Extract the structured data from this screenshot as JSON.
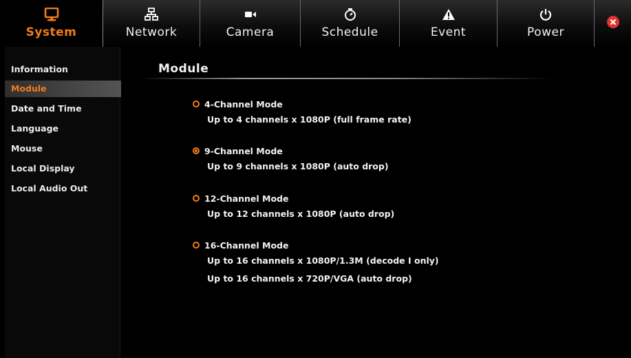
{
  "nav": {
    "tabs": [
      {
        "label": "System",
        "icon": "monitor-icon",
        "active": true
      },
      {
        "label": "Network",
        "icon": "network-icon",
        "active": false
      },
      {
        "label": "Camera",
        "icon": "camera-icon",
        "active": false
      },
      {
        "label": "Schedule",
        "icon": "clock-icon",
        "active": false
      },
      {
        "label": "Event",
        "icon": "warning-icon",
        "active": false
      },
      {
        "label": "Power",
        "icon": "power-icon",
        "active": false
      }
    ],
    "close_icon": "close-icon"
  },
  "sidebar": {
    "items": [
      {
        "label": "Information"
      },
      {
        "label": "Module",
        "active": true
      },
      {
        "label": "Date and Time"
      },
      {
        "label": "Language"
      },
      {
        "label": "Mouse"
      },
      {
        "label": "Local Display"
      },
      {
        "label": "Local Audio Out"
      }
    ]
  },
  "main": {
    "title": "Module",
    "modes": [
      {
        "label": "4-Channel Mode",
        "selected": false,
        "desc": [
          "Up to 4 channels x 1080P (full frame rate)"
        ]
      },
      {
        "label": "9-Channel Mode",
        "selected": true,
        "desc": [
          "Up to 9 channels x 1080P (auto drop)"
        ]
      },
      {
        "label": "12-Channel Mode",
        "selected": false,
        "desc": [
          "Up to 12 channels x 1080P (auto drop)"
        ]
      },
      {
        "label": "16-Channel Mode",
        "selected": false,
        "desc": [
          "Up to 16 channels x 1080P/1.3M (decode I only)",
          "Up to 16 channels x 720P/VGA (auto drop)"
        ]
      }
    ]
  },
  "colors": {
    "accent": "#f07d1b",
    "close": "#e0342f"
  }
}
